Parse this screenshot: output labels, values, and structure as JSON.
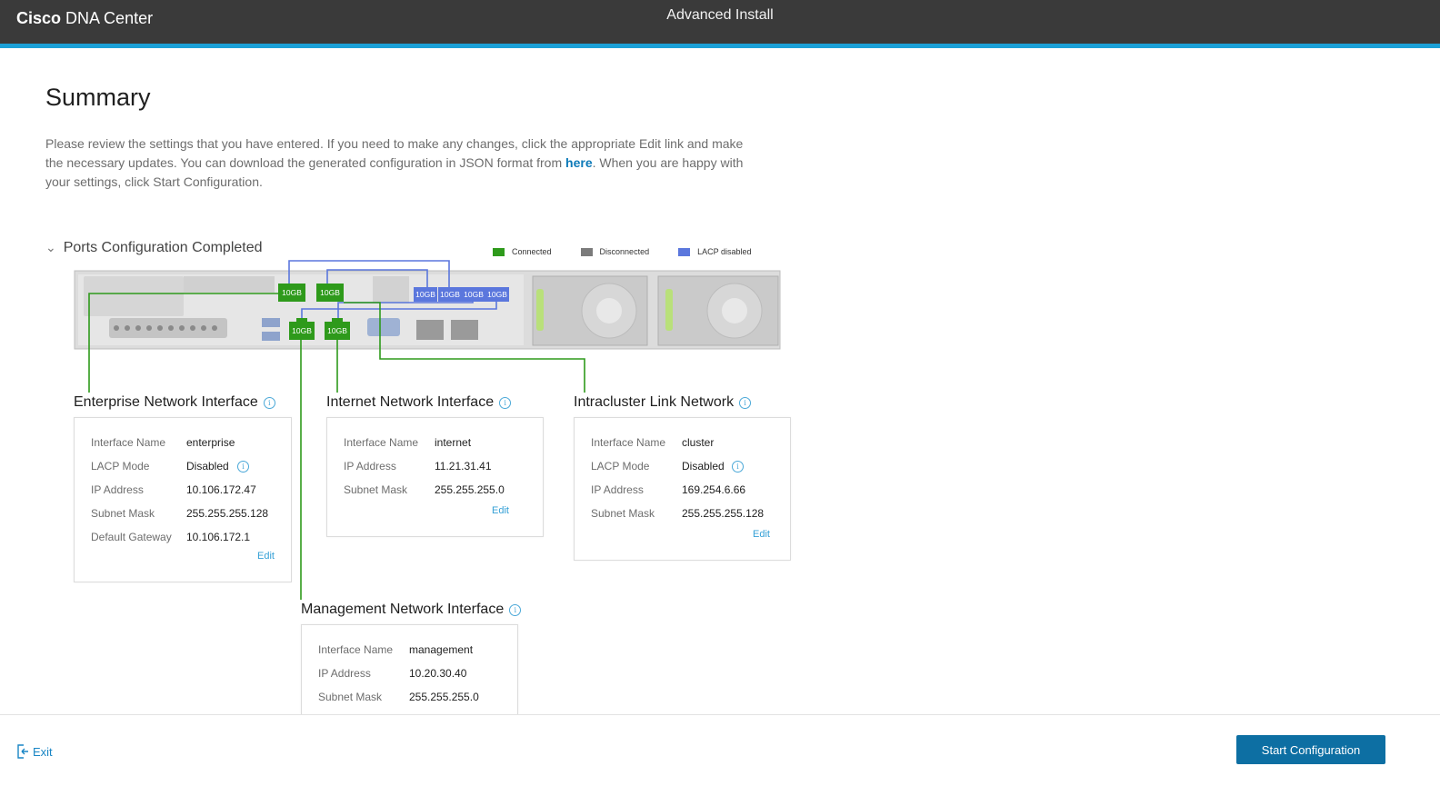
{
  "header": {
    "brand_strong": "Cisco",
    "brand_rest": "DNA Center",
    "caption": "Advanced Install"
  },
  "summary": {
    "title": "Summary",
    "intro_before_link": "Please review the settings that you have entered. If you need to make any changes, click the appropriate Edit link and make the necessary updates. You can download the generated configuration in JSON format from ",
    "intro_link": "here",
    "intro_after_link": ". When you are happy with your settings, click Start Configuration."
  },
  "ports": {
    "section_title": "Ports Configuration Completed",
    "legend": [
      {
        "label": "Connected",
        "color": "#2e9a1b"
      },
      {
        "label": "Disconnected",
        "color": "#7b7b7b"
      },
      {
        "label": "LACP disabled",
        "color": "#5b77dd"
      }
    ],
    "port_label": "10GB"
  },
  "enterprise": {
    "title": "Enterprise Network Interface",
    "rows": [
      {
        "label": "Interface Name",
        "value": "enterprise"
      },
      {
        "label": "LACP Mode",
        "value": "Disabled"
      },
      {
        "label": "IP Address",
        "value": "10.106.172.47"
      },
      {
        "label": "Subnet Mask",
        "value": "255.255.255.128"
      },
      {
        "label": "Default Gateway",
        "value": "10.106.172.1"
      }
    ],
    "edit": "Edit"
  },
  "internet": {
    "title": "Internet Network Interface",
    "rows": [
      {
        "label": "Interface Name",
        "value": "internet"
      },
      {
        "label": "IP Address",
        "value": "11.21.31.41"
      },
      {
        "label": "Subnet Mask",
        "value": "255.255.255.0"
      }
    ],
    "edit": "Edit"
  },
  "intracluster": {
    "title": "Intracluster Link Network",
    "rows": [
      {
        "label": "Interface Name",
        "value": "cluster"
      },
      {
        "label": "LACP Mode",
        "value": "Disabled"
      },
      {
        "label": "IP Address",
        "value": "169.254.6.66"
      },
      {
        "label": "Subnet Mask",
        "value": "255.255.255.128"
      }
    ],
    "edit": "Edit"
  },
  "management": {
    "title": "Management Network Interface",
    "rows": [
      {
        "label": "Interface Name",
        "value": "management"
      },
      {
        "label": "IP Address",
        "value": "10.20.30.40"
      },
      {
        "label": "Subnet Mask",
        "value": "255.255.255.0"
      }
    ]
  },
  "footer": {
    "exit_label": "Exit",
    "start_label": "Start Configuration"
  },
  "colors": {
    "accent": "#1ba0d7",
    "connected": "#2e9a1b",
    "lacp_disabled": "#5b77dd",
    "primary_button": "#0d6fa3"
  }
}
